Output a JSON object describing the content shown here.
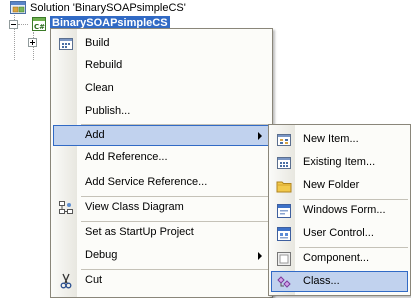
{
  "tree": {
    "solution_label": "Solution 'BinarySOAPsimpleCS'",
    "project_label": "BinarySOAPsimpleCS"
  },
  "context_menu": {
    "items": [
      {
        "label": "Build",
        "icon": "build-icon"
      },
      {
        "label": "Rebuild",
        "icon": ""
      },
      {
        "label": "Clean",
        "icon": ""
      },
      {
        "label": "Publish...",
        "icon": ""
      },
      {
        "label": "Add",
        "icon": "",
        "submenu": true,
        "highlighted": true
      },
      {
        "label": "Add Reference...",
        "icon": ""
      },
      {
        "label": "Add Service Reference...",
        "icon": ""
      },
      {
        "label": "View Class Diagram",
        "icon": "class-diagram-icon"
      },
      {
        "label": "Set as StartUp Project",
        "icon": ""
      },
      {
        "label": "Debug",
        "icon": "",
        "submenu": true
      },
      {
        "label": "Cut",
        "icon": "scissors-icon"
      }
    ]
  },
  "add_submenu": {
    "items": [
      {
        "label": "New Item...",
        "icon": "new-item-icon"
      },
      {
        "label": "Existing Item...",
        "icon": "existing-item-icon"
      },
      {
        "label": "New Folder",
        "icon": "folder-icon"
      },
      {
        "label": "Windows Form...",
        "icon": "windows-form-icon"
      },
      {
        "label": "User Control...",
        "icon": "user-control-icon"
      },
      {
        "label": "Component...",
        "icon": "component-icon"
      },
      {
        "label": "Class...",
        "icon": "class-icon",
        "highlighted": true
      }
    ]
  },
  "colors": {
    "selection": "#316ac5",
    "menu_highlight": "#c1d2ee",
    "menu_background": "#fcfcf9",
    "menu_border": "#8a867a"
  }
}
